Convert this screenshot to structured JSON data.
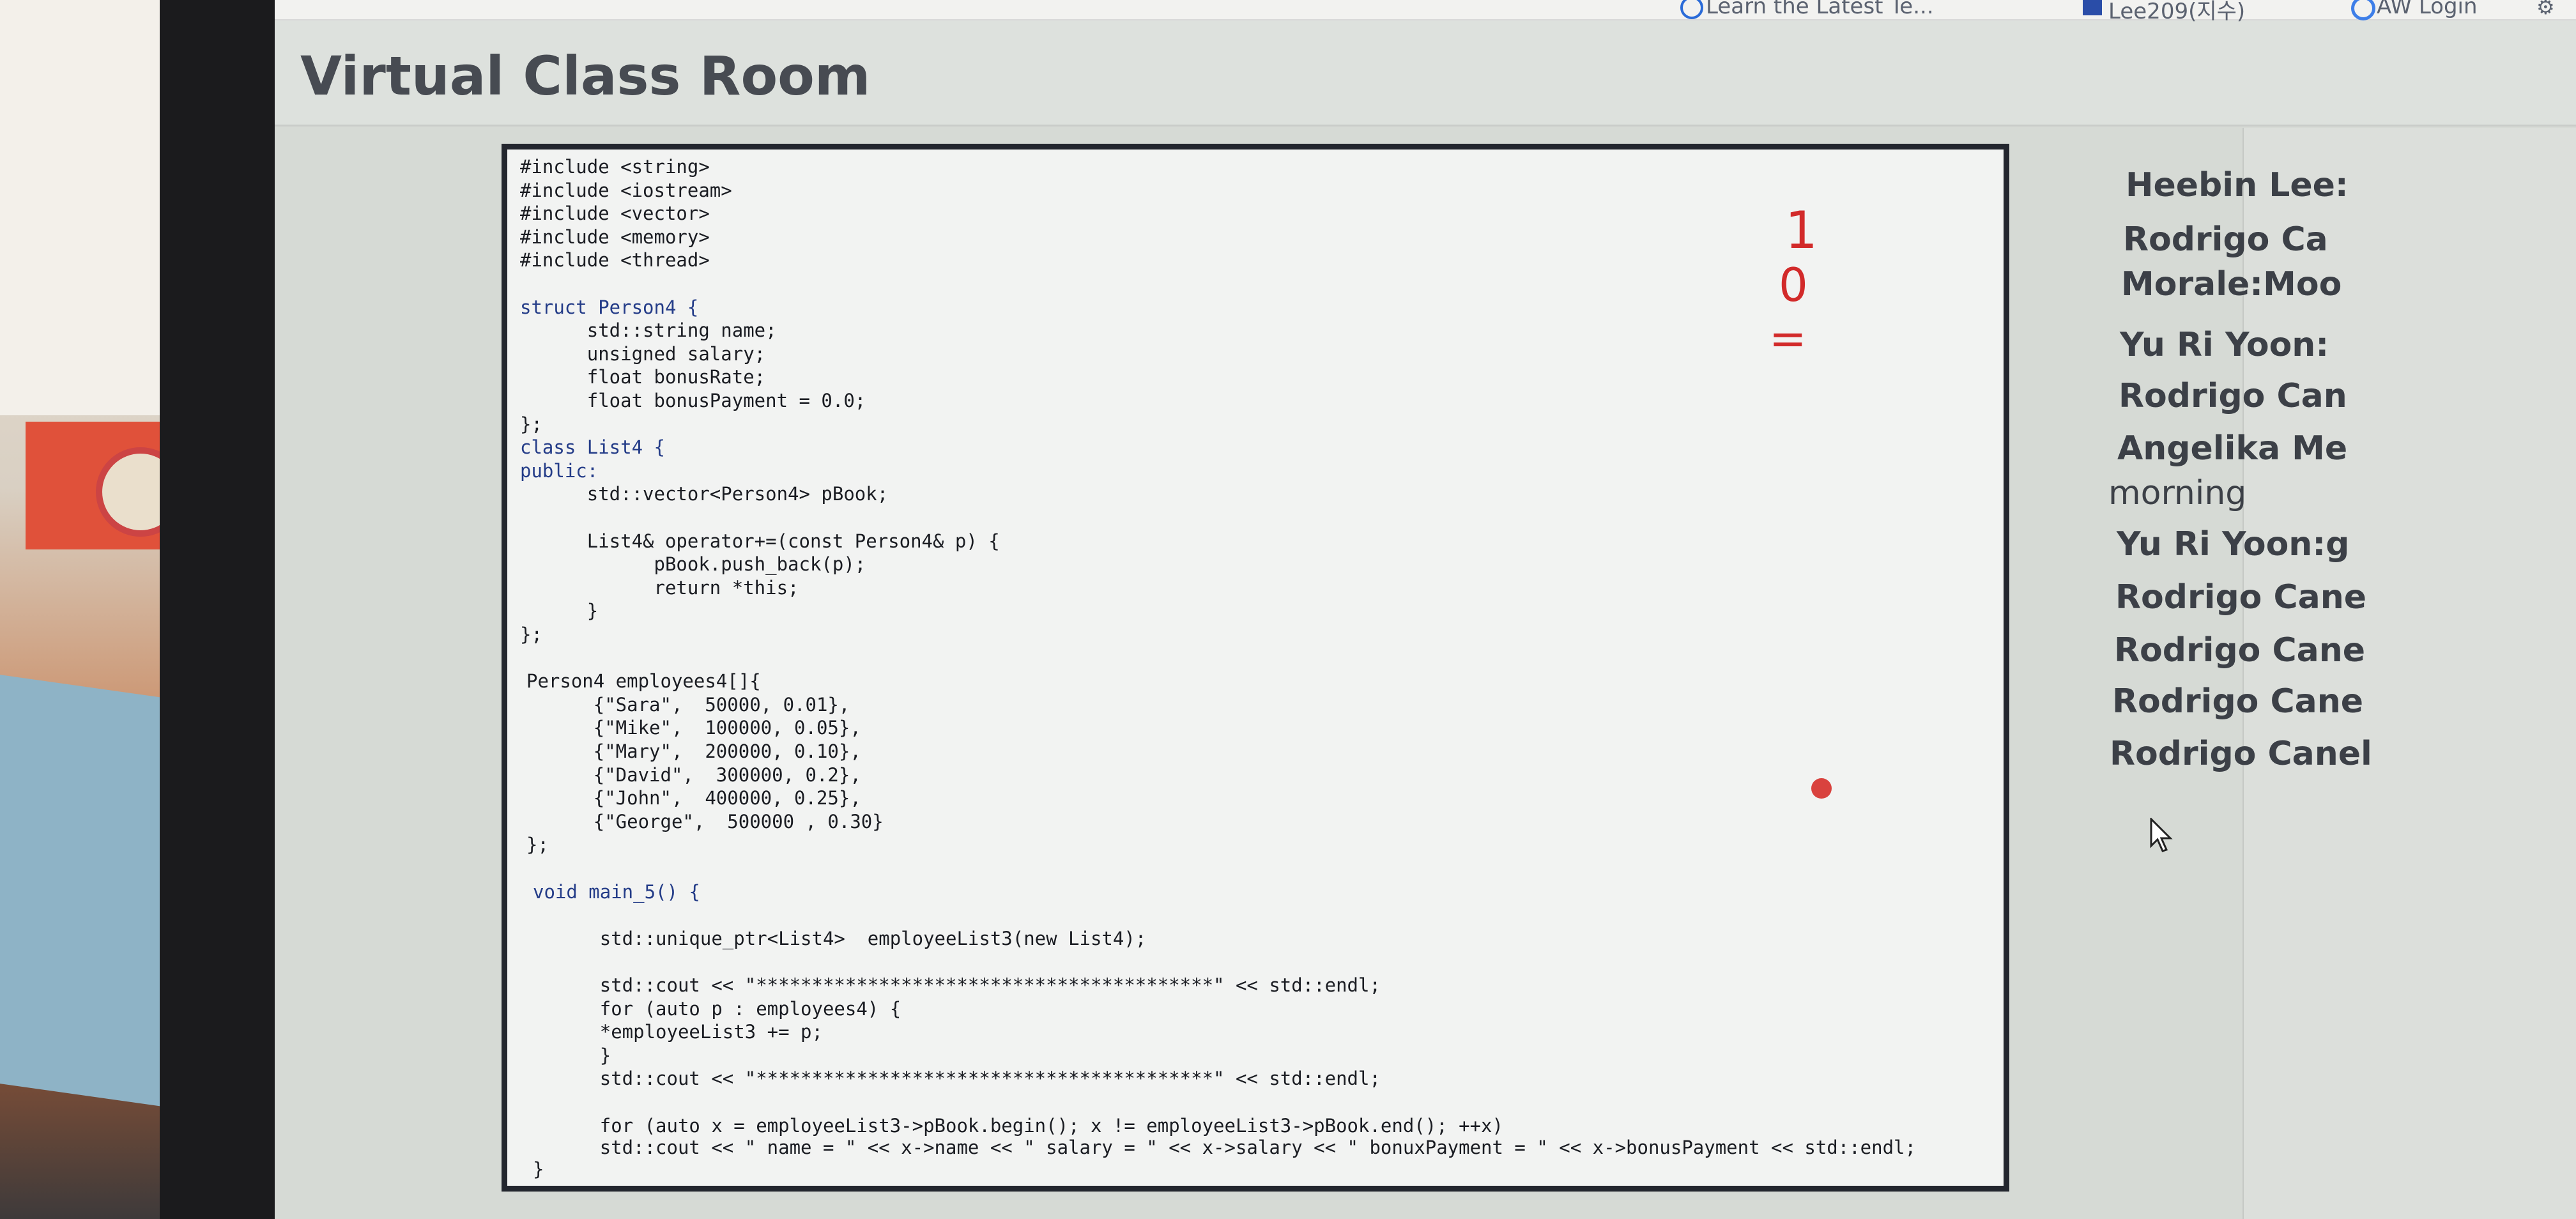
{
  "page": {
    "title": "Virtual Class Room"
  },
  "browser": {
    "bookmarks": [
      "Learn the Latest Te...",
      "Lee209(지수)",
      "AW Login"
    ]
  },
  "icons": {
    "bookmark_1": "globe-icon",
    "bookmark_2": "square-icon",
    "bookmark_3": "google-icon",
    "settings": "settings-icon",
    "cursor": "mouse-pointer-icon"
  },
  "code": {
    "lines": [
      "#include <string>",
      "#include <iostream>",
      "#include <vector>",
      "#include <memory>",
      "#include <thread>",
      "",
      "struct Person4 {",
      "      std::string name;",
      "      unsigned salary;",
      "      float bonusRate;",
      "      float bonusPayment = 0.0;",
      "};",
      "class List4 {",
      "public:",
      "      std::vector<Person4> pBook;",
      "",
      "      List4& operator+=(const Person4& p) {",
      "            pBook.push_back(p);",
      "            return *this;",
      "      }",
      "};",
      "",
      "Person4 employees4[]{",
      "      {\"Sara\",  50000, 0.01},",
      "      {\"Mike\",  100000, 0.05},",
      "      {\"Mary\",  200000, 0.10},",
      "      {\"David\",  300000, 0.2},",
      "      {\"John\",  400000, 0.25},",
      "      {\"George\",  500000 , 0.30}",
      "};",
      "",
      "void main_5() {",
      "",
      "      std::unique_ptr<List4>  employeeList3(new List4);",
      "",
      "      std::cout << \"*****************************************\" << std::endl;",
      "      for (auto p : employees4) {",
      "      *employeeList3 += p;",
      "      }",
      "      std::cout << \"*****************************************\" << std::endl;",
      "",
      "      for (auto x = employeeList3->pBook.begin(); x != employeeList3->pBook.end(); ++x)",
      "      std::cout << \" name = \" << x->name << \" salary = \" << x->salary << \" bonuxPayment = \" << x->bonusPayment << std::endl;",
      "}"
    ],
    "annotations": [
      "1",
      "0",
      "="
    ]
  },
  "chat": {
    "messages": [
      "Heebin Lee:",
      "Rodrigo Ca",
      "Morale:Moo",
      "Yu Ri Yoon:",
      "Rodrigo Can",
      "Angelika Me",
      "morning",
      "Yu Ri Yoon:g",
      "Rodrigo Cane",
      "Rodrigo Cane",
      "Rodrigo Cane",
      "Rodrigo Canel"
    ]
  },
  "colors": {
    "annotation": "#d22a2a",
    "code_frame": "#23262e",
    "title": "#474b52"
  }
}
